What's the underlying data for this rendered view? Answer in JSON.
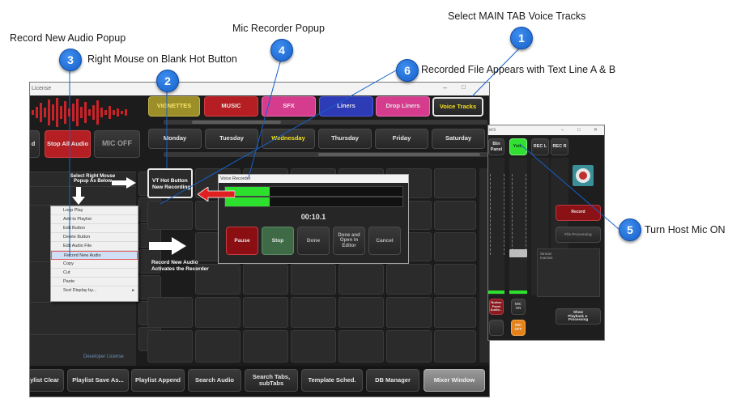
{
  "callouts": {
    "c1": {
      "num": "1",
      "text": "Select MAIN TAB Voice Tracks"
    },
    "c2": {
      "num": "2",
      "text": "Right Mouse on Blank  Hot Button"
    },
    "c3": {
      "num": "3",
      "text": "Record New Audio Popup"
    },
    "c4": {
      "num": "4",
      "text": "Mic Recorder Popup"
    },
    "c5": {
      "num": "5",
      "text": "Turn Host Mic ON"
    },
    "c6": {
      "num": "6",
      "text": "Recorded File Appears with Text Line A & B"
    }
  },
  "main_window": {
    "title": "License",
    "category_tabs": [
      "VIGNETTES",
      "MUSIC",
      "SFX",
      "Liners",
      "Drop Liners",
      "Voice Tracks"
    ],
    "day_tabs": [
      "Monday",
      "Tuesday",
      "Wednesday",
      "Thursday",
      "Friday",
      "Saturday"
    ],
    "left_buttons": {
      "partial": "d",
      "stop_all": "Stop All Audio",
      "mic_off": "MIC OFF"
    },
    "hint_select": "Select Right Mouse\nPopup As Below",
    "hot_button": "VT Hot Button\nNew Recording",
    "hint_record": "Record New Audio\nActivates the Recorder",
    "developer_license": "Developer License",
    "bottom_buttons": [
      "ylist Clear",
      "Playlist Save As...",
      "Playlist Append",
      "Search Audio",
      "Search Tabs,\nsubTabs",
      "Template Sched.",
      "DB Manager",
      "Mixer Window"
    ]
  },
  "context_menu": {
    "items": [
      "Loop Play",
      "Add to Playlist",
      "Edit Button",
      "Delete Button",
      "Edit Audio File",
      "Record New Audio",
      "Copy",
      "Cut",
      "Paste",
      "Sort Display by..."
    ],
    "highlighted": "Record New Audio"
  },
  "recorder": {
    "title": "Voice Recorder",
    "time": "00:10.1",
    "level_fraction": 0.25,
    "buttons": [
      "Pause",
      "Stop",
      "Done",
      "Done and\nOpen in\nEditor",
      "Cancel"
    ]
  },
  "mixer": {
    "title": "ers",
    "headers": [
      "Btn\nPanel",
      "Yeti..",
      "REC L",
      "REC R"
    ],
    "record_label": "Record",
    "file_processing": "File Processing",
    "stream_label": "Stream\nInactive",
    "show_playback": "Show\nPlayback ►\nProcessing",
    "small_buttons": [
      "Button\nPanel\nAudio...",
      "MIC\nON",
      "MIC\nOFF"
    ]
  },
  "colors": {
    "accent_blue": "#1560c9",
    "arrow_red": "#e02020",
    "voice_yellow": "#f4e01a"
  }
}
